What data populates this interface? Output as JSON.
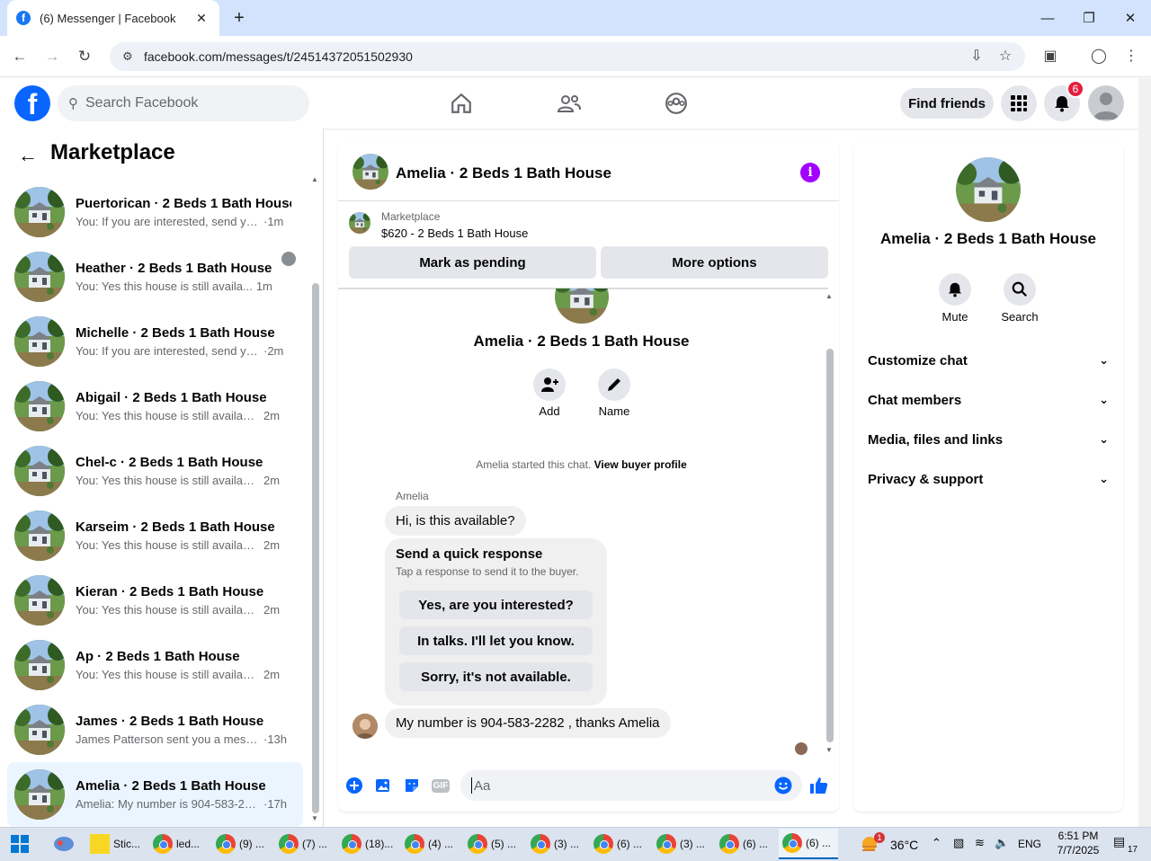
{
  "browser": {
    "tab_title": "(6) Messenger | Facebook",
    "url": "facebook.com/messages/t/24514372051502930",
    "new_tab": "+",
    "minimize": "—",
    "restore": "❐",
    "close": "✕"
  },
  "fb": {
    "logo": "f",
    "search_placeholder": "Search Facebook",
    "find_friends": "Find friends",
    "notif_count": "6"
  },
  "left": {
    "title": "Marketplace",
    "conversations": [
      {
        "name": "Puertorican · 2 Beds 1 Bath House",
        "snippet": "You: If you are interested, send yo...",
        "time": "·1m"
      },
      {
        "name": "Heather · 2 Beds 1 Bath House",
        "snippet": "You: Yes this house is still availa...",
        "time": "1m"
      },
      {
        "name": "Michelle · 2 Beds 1 Bath House",
        "snippet": "You: If you are interested, send yo...",
        "time": "·2m"
      },
      {
        "name": "Abigail · 2 Beds 1 Bath House",
        "snippet": "You: Yes this house is still available ...",
        "time": "2m"
      },
      {
        "name": "Chel-c · 2 Beds 1 Bath House",
        "snippet": "You: Yes this house is still available ...",
        "time": "2m"
      },
      {
        "name": "Karseim · 2 Beds 1 Bath House",
        "snippet": "You: Yes this house is still available ...",
        "time": "2m"
      },
      {
        "name": "Kieran · 2 Beds 1 Bath House",
        "snippet": "You: Yes this house is still available ...",
        "time": "2m"
      },
      {
        "name": "Ap · 2 Beds 1 Bath House",
        "snippet": "You: Yes this house is still available ...",
        "time": "2m"
      },
      {
        "name": "James · 2 Beds 1 Bath House",
        "snippet": "James Patterson sent you a messa...",
        "time": "·13h"
      },
      {
        "name": "Amelia · 2 Beds 1 Bath House",
        "snippet": "Amelia: My number is 904-583-22...",
        "time": "·17h"
      }
    ]
  },
  "chat": {
    "title": "Amelia · 2 Beds 1 Bath House",
    "info_icon": "i",
    "marketplace_label": "Marketplace",
    "listing": "$620 - 2 Beds 1 Bath House",
    "mark_pending": "Mark as pending",
    "more_options": "More options",
    "center_name": "Amelia · 2 Beds 1 Bath House",
    "add_label": "Add",
    "name_label": "Name",
    "started_text": "Amelia started this chat.",
    "view_profile": "View buyer profile",
    "sender": "Amelia",
    "msg1": "Hi, is this available?",
    "qr_title": "Send a quick response",
    "qr_sub": "Tap a response to send it to the buyer.",
    "qr_options": [
      "Yes, are you interested?",
      "In talks. I'll let you know.",
      "Sorry, it's not available."
    ],
    "msg2": "My number is 904-583-2282 , thanks Amelia",
    "composer_placeholder": "Aa",
    "gif": "GIF"
  },
  "right": {
    "name": "Amelia · 2 Beds 1 Bath House",
    "mute": "Mute",
    "search": "Search",
    "sections": [
      "Customize chat",
      "Chat members",
      "Media, files and links",
      "Privacy & support"
    ]
  },
  "taskbar": {
    "items": [
      "Stic...",
      "led...",
      "(9) ...",
      "(7) ...",
      "(18)...",
      "(4) ...",
      "(5) ...",
      "(3) ...",
      "(6) ...",
      "(3) ...",
      "(6) ...",
      "(6) ..."
    ],
    "weather": "36°C",
    "weather_badge": "1",
    "lang": "ENG",
    "time": "6:51 PM",
    "date": "7/7/2025",
    "notif": "17"
  },
  "colors": {
    "fb_blue": "#0866ff",
    "selected_row": "#ebf5ff",
    "info_purple": "#a100ff",
    "badge_red": "#e41e3f"
  }
}
